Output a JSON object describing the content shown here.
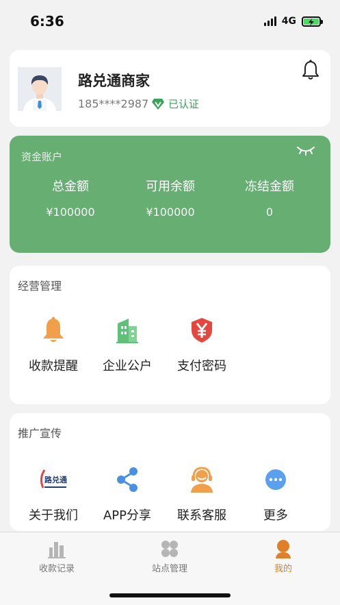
{
  "status_bar": {
    "time": "6:36",
    "network": "4G"
  },
  "profile": {
    "name": "路兑通商家",
    "phone": "185****2987",
    "verified_label": "已认证"
  },
  "fund_account": {
    "title": "资金账户",
    "columns": [
      {
        "label": "总金额",
        "value": "¥100000"
      },
      {
        "label": "可用余额",
        "value": "¥100000"
      },
      {
        "label": "冻结金额",
        "value": "0"
      }
    ]
  },
  "business": {
    "title": "经营管理",
    "items": [
      {
        "label": "收款提醒",
        "icon": "bell-icon",
        "color": "#f0a04b"
      },
      {
        "label": "企业公户",
        "icon": "building-icon",
        "color": "#5fc07a"
      },
      {
        "label": "支付密码",
        "icon": "yuan-shield-icon",
        "color": "#e5473f"
      }
    ]
  },
  "promotion": {
    "title": "推广宣传",
    "items": [
      {
        "label": "关于我们",
        "icon": "logo-icon",
        "logo_text": "路兑通"
      },
      {
        "label": "APP分享",
        "icon": "share-icon",
        "color": "#4a90e2"
      },
      {
        "label": "联系客服",
        "icon": "customer-service-icon",
        "color": "#f0a04b"
      },
      {
        "label": "更多",
        "icon": "more-icon",
        "color": "#5aa0ee"
      }
    ]
  },
  "tabbar": {
    "tabs": [
      {
        "label": "收款记录",
        "icon": "bar-chart-icon",
        "active": false
      },
      {
        "label": "站点管理",
        "icon": "grid-icon",
        "active": false
      },
      {
        "label": "我的",
        "icon": "user-icon",
        "active": true
      }
    ],
    "active_color": "#e07f27"
  },
  "colors": {
    "fund_bg": "#66ae72",
    "page_bg": "#f2f2f2"
  }
}
